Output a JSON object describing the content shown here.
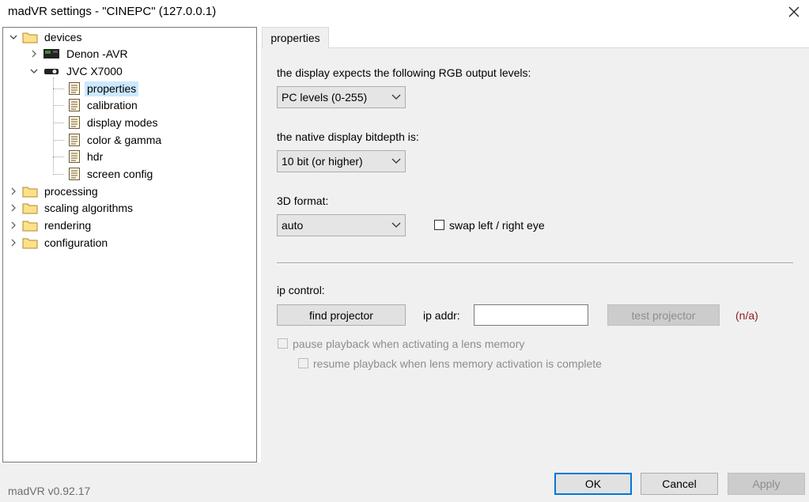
{
  "window": {
    "title": "madVR settings - \"CINEPC\" (127.0.0.1)",
    "close_icon": "close-icon"
  },
  "tree": {
    "items": [
      {
        "id": "devices",
        "label": "devices",
        "expanded": true,
        "icon": "folder-icon"
      },
      {
        "id": "denon",
        "label": "Denon -AVR",
        "expanded": false,
        "icon": "receiver-icon"
      },
      {
        "id": "jvc",
        "label": "JVC X7000",
        "expanded": true,
        "icon": "projector-icon"
      },
      {
        "id": "properties",
        "label": "properties",
        "selected": true,
        "icon": "document-icon"
      },
      {
        "id": "calibration",
        "label": "calibration",
        "icon": "document-icon"
      },
      {
        "id": "display-modes",
        "label": "display modes",
        "icon": "document-icon"
      },
      {
        "id": "color-gamma",
        "label": "color & gamma",
        "icon": "document-icon"
      },
      {
        "id": "hdr",
        "label": "hdr",
        "icon": "document-icon"
      },
      {
        "id": "screen-config",
        "label": "screen config",
        "icon": "document-icon"
      },
      {
        "id": "processing",
        "label": "processing",
        "expanded": false,
        "icon": "folder-icon"
      },
      {
        "id": "scaling",
        "label": "scaling algorithms",
        "expanded": false,
        "icon": "folder-icon"
      },
      {
        "id": "rendering",
        "label": "rendering",
        "expanded": false,
        "icon": "folder-icon"
      },
      {
        "id": "configuration",
        "label": "configuration",
        "expanded": false,
        "icon": "folder-icon"
      }
    ]
  },
  "tabs": [
    {
      "label": "properties",
      "active": true
    }
  ],
  "properties": {
    "rgb_label": "the display expects the following RGB output levels:",
    "rgb_value": "PC levels (0-255)",
    "bitdepth_label": "the native display bitdepth is:",
    "bitdepth_value": "10 bit (or higher)",
    "format3d_label": "3D format:",
    "format3d_value": "auto",
    "swap_eye_label": "swap left / right eye",
    "swap_eye_checked": false,
    "ip_control_label": "ip control:",
    "find_projector_label": "find projector",
    "ip_addr_label": "ip addr:",
    "ip_addr_value": "",
    "test_projector_label": "test projector",
    "status_text": "(n/a)",
    "status_color": "#8b1a1a",
    "pause_label": "pause playback when activating a lens memory",
    "resume_label": "resume playback when lens memory activation is complete"
  },
  "footer": {
    "version": "madVR v0.92.17",
    "ok_label": "OK",
    "cancel_label": "Cancel",
    "apply_label": "Apply"
  },
  "colors": {
    "selection": "#cce8ff",
    "default_button_border": "#0078d7",
    "panel_background": "#f0f0f0"
  }
}
